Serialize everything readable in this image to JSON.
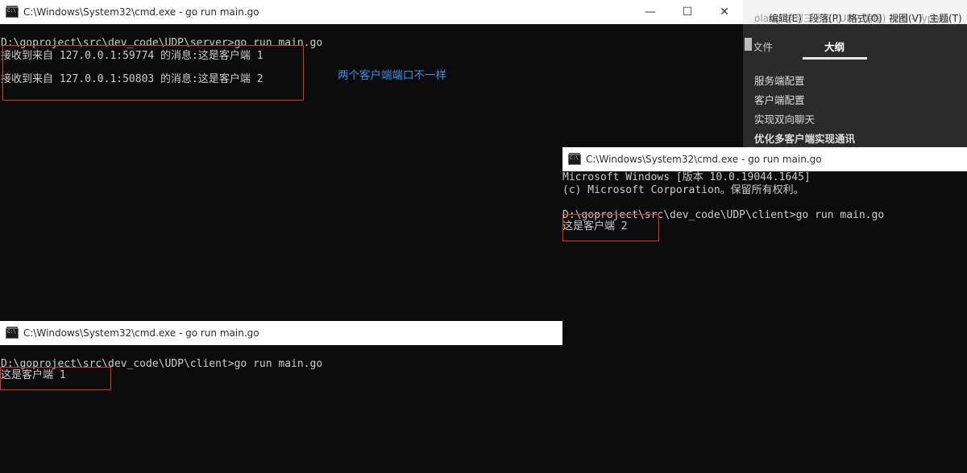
{
  "typora": {
    "title_ghost": "olang 学习三十五 (UDP 编程) .md - Typora",
    "menu": [
      "编辑(E)",
      "段落(P)",
      "格式(O)",
      "视图(V)",
      "主题(T)"
    ],
    "tabs": [
      "文件",
      "大纲"
    ],
    "outline": [
      "服务端配置",
      "客户端配置",
      "实现双向聊天",
      "优化多客户端实现通讯"
    ]
  },
  "server_window": {
    "title": "C:\\Windows\\System32\\cmd.exe - go  run main.go",
    "controls": [
      "—",
      "☐",
      "✕"
    ],
    "lines": [
      "D:\\goproject\\src\\dev_code\\UDP\\server>go run main.go",
      "接收到来自 127.0.0.1:59774 的消息:这是客户端 1",
      "接收到来自 127.0.0.1:50803 的消息:这是客户端 2"
    ],
    "annotation": "两个客户端端口不一样"
  },
  "client1_window": {
    "title": "C:\\Windows\\System32\\cmd.exe - go  run main.go",
    "lines": [
      "D:\\goproject\\src\\dev_code\\UDP\\client>go run main.go",
      "这是客户端 1"
    ]
  },
  "client2_window": {
    "title": "C:\\Windows\\System32\\cmd.exe - go  run main.go",
    "lines": [
      "Microsoft Windows [版本 10.0.19044.1645]",
      "(c) Microsoft Corporation。保留所有权利。",
      "D:\\goproject\\src\\dev_code\\UDP\\client>go run main.go",
      "这是客户端 2"
    ]
  },
  "colors": {
    "terminal_bg": "#0c0c0c",
    "terminal_text": "#cccccc",
    "highlight_box": "#e0322f",
    "annotation_text": "#3a8ee6"
  }
}
